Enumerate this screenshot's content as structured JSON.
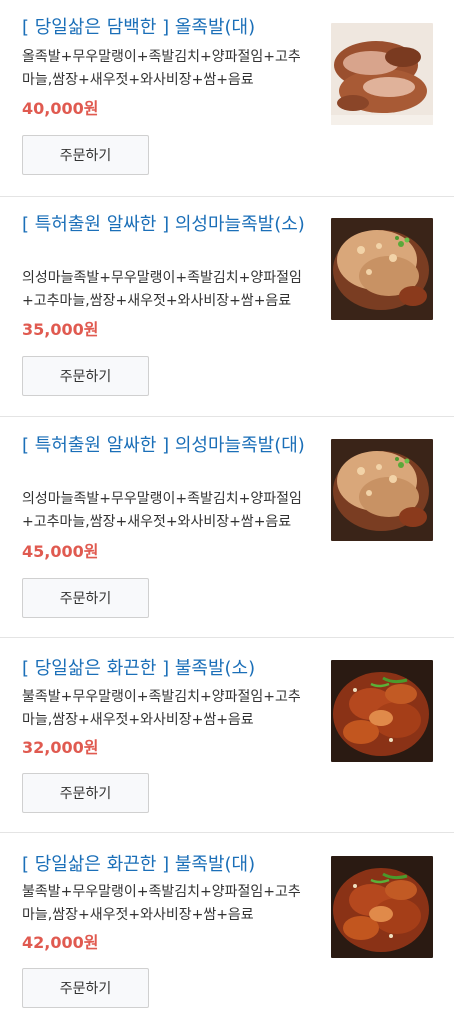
{
  "menu": {
    "items": [
      {
        "title": "[ 당일삶은 담백한 ] 올족발(대)",
        "description": "올족발+무우말랭이+족발김치+양파절임+고추마늘,쌈장+새우젓+와사비장+쌈+음료",
        "price": "40,000원",
        "button_label": "주문하기",
        "image_icon": "plain-jokbal-photo"
      },
      {
        "title": "[ 특허출원 알싸한 ] 의성마늘족발(소)",
        "description": "의성마늘족발+무우말랭이+족발김치+양파절임+고추마늘,쌈장+새우젓+와사비장+쌈+음료",
        "price": "35,000원",
        "button_label": "주문하기",
        "image_icon": "garlic-jokbal-photo"
      },
      {
        "title": "[ 특허출원 알싸한 ] 의성마늘족발(대)",
        "description": "의성마늘족발+무우말랭이+족발김치+양파절임+고추마늘,쌈장+새우젓+와사비장+쌈+음료",
        "price": "45,000원",
        "button_label": "주문하기",
        "image_icon": "garlic-jokbal-photo"
      },
      {
        "title": "[ 당일삶은 화끈한 ] 불족발(소)",
        "description": "불족발+무우말랭이+족발김치+양파절임+고추마늘,쌈장+새우젓+와사비장+쌈+음료",
        "price": "32,000원",
        "button_label": "주문하기",
        "image_icon": "spicy-jokbal-photo"
      },
      {
        "title": "[ 당일삶은 화끈한 ] 불족발(대)",
        "description": "불족발+무우말랭이+족발김치+양파절임+고추마늘,쌈장+새우젓+와사비장+쌈+음료",
        "price": "42,000원",
        "button_label": "주문하기",
        "image_icon": "spicy-jokbal-photo"
      }
    ]
  },
  "colors": {
    "title": "#1b6fb8",
    "price": "#e05a50",
    "divider": "#e4e4e4"
  }
}
